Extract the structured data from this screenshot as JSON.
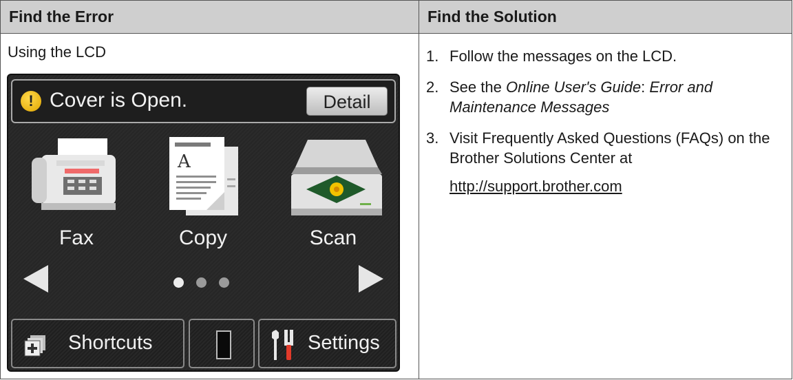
{
  "table": {
    "header_left": "Find the Error",
    "header_right": "Find the Solution"
  },
  "left": {
    "caption": "Using the LCD",
    "lcd": {
      "status_text": "Cover is Open.",
      "detail_button": "Detail",
      "apps": [
        {
          "label": "Fax",
          "icon": "fax-icon"
        },
        {
          "label": "Copy",
          "icon": "copy-icon"
        },
        {
          "label": "Scan",
          "icon": "scan-icon"
        }
      ],
      "page_indicator": {
        "current": 1,
        "total": 3
      },
      "bottom_buttons": {
        "shortcuts": "Shortcuts",
        "settings": "Settings"
      },
      "colors": {
        "warning": "#f0b400",
        "screen_bg": "#262626"
      }
    }
  },
  "right": {
    "steps": [
      {
        "num": "1.",
        "text": "Follow the messages on the LCD."
      },
      {
        "num": "2.",
        "prefix": "See the ",
        "guide": "Online User's Guide",
        "sep": ": ",
        "topic": "Error and Maintenance Messages"
      },
      {
        "num": "3.",
        "text": "Visit Frequently Asked Questions (FAQs) on the Brother Solutions Center at"
      }
    ],
    "url": "http://support.brother.com"
  }
}
